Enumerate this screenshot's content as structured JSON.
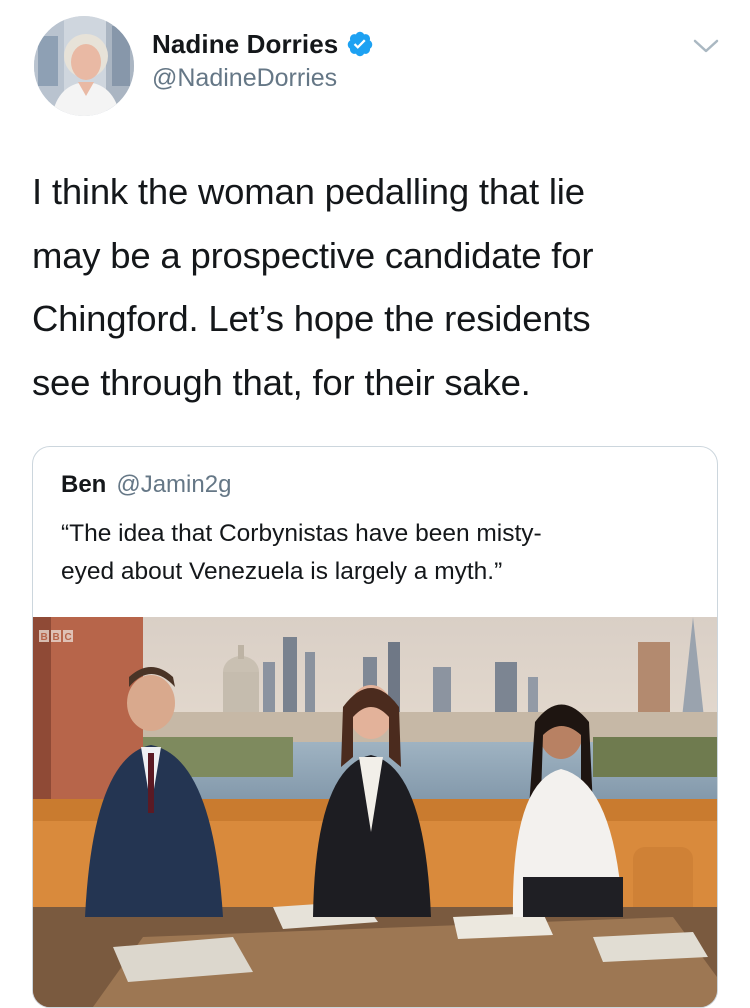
{
  "author": {
    "display_name": "Nadine Dorries",
    "handle": "@NadineDorries",
    "verified": true,
    "avatar_icon": "avatar-photo"
  },
  "tweet": {
    "text": "I think the woman pedalling that lie\nmay be a prospective candidate for\nChingford. Let’s hope the residents\nsee through that, for their sake."
  },
  "quoted_tweet": {
    "display_name": "Ben",
    "handle": "@Jamin2g",
    "text": "“The idea that Corbynistas have been misty-\neyed about Venezuela is largely a myth.”",
    "media": {
      "logo_text": "BBC",
      "description_icon": "tv-studio-photo"
    }
  },
  "colors": {
    "verified_blue": "#1da1f2",
    "secondary_text": "#657786",
    "border": "#ccd6dd",
    "sofa_orange": "#d98a3c"
  }
}
